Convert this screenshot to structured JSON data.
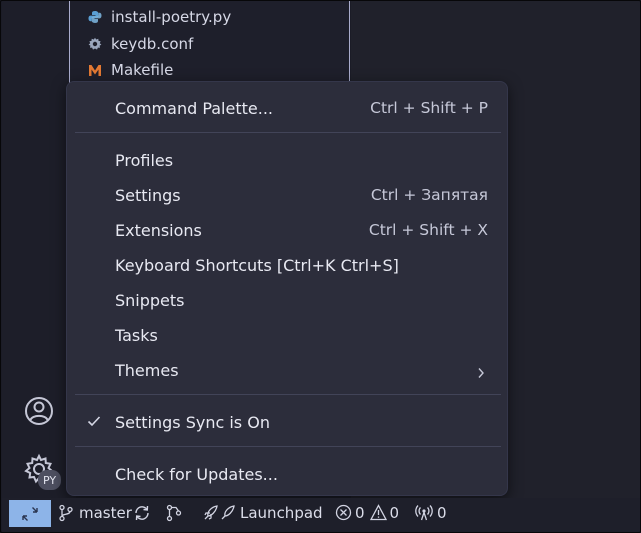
{
  "explorer": {
    "files": [
      {
        "name": "install-poetry.py",
        "icon": "python-file-icon"
      },
      {
        "name": "keydb.conf",
        "icon": "gear-file-icon"
      },
      {
        "name": "Makefile",
        "icon": "makefile-icon"
      }
    ]
  },
  "menu": {
    "command_palette": {
      "label": "Command Palette...",
      "shortcut": "Ctrl + Shift + P"
    },
    "profiles": {
      "label": "Profiles"
    },
    "settings": {
      "label": "Settings",
      "shortcut": "Ctrl + Запятая"
    },
    "extensions": {
      "label": "Extensions",
      "shortcut": "Ctrl + Shift + X"
    },
    "keyboard_shortcuts": {
      "label": "Keyboard Shortcuts [Ctrl+K Ctrl+S]"
    },
    "snippets": {
      "label": "Snippets"
    },
    "tasks": {
      "label": "Tasks"
    },
    "themes": {
      "label": "Themes"
    },
    "settings_sync": {
      "label": "Settings Sync is On",
      "checked": true
    },
    "check_updates": {
      "label": "Check for Updates..."
    }
  },
  "activity_bar": {
    "manage_badge": "PY"
  },
  "status_bar": {
    "branch": "master",
    "launchpad": "Launchpad",
    "errors": "0",
    "warnings": "0",
    "ports": "0"
  },
  "colors": {
    "menu_bg": "#2c2d3b",
    "remote_accent": "#8db4e8",
    "python_icon": "#5a9fd4",
    "makefile_icon": "#e37933"
  }
}
